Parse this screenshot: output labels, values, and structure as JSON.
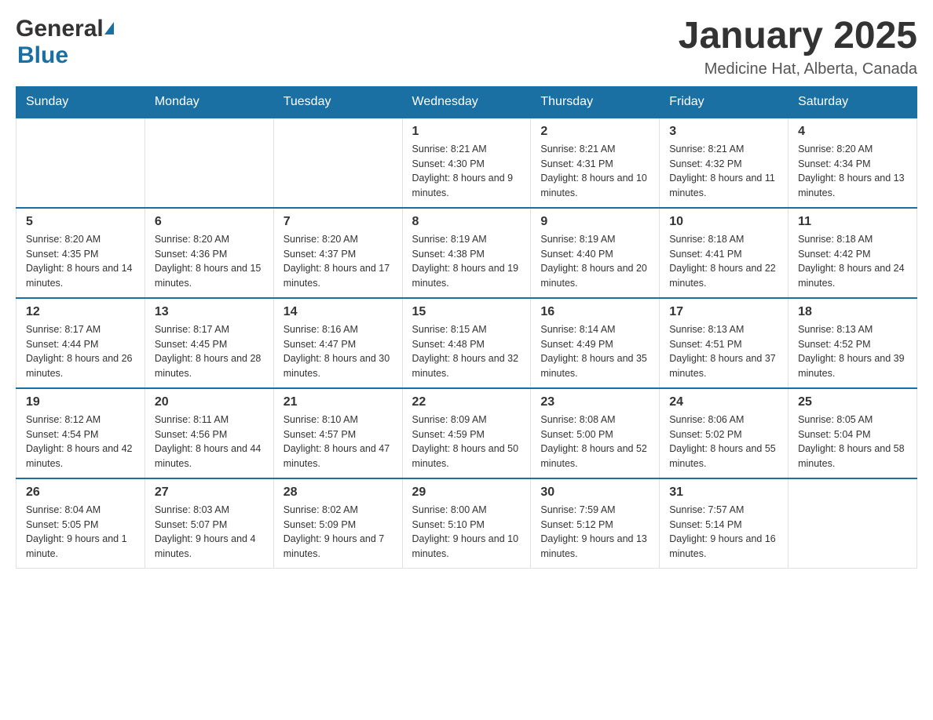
{
  "header": {
    "logo_general": "General",
    "logo_blue": "Blue",
    "title": "January 2025",
    "location": "Medicine Hat, Alberta, Canada"
  },
  "days_of_week": [
    "Sunday",
    "Monday",
    "Tuesday",
    "Wednesday",
    "Thursday",
    "Friday",
    "Saturday"
  ],
  "weeks": [
    [
      {
        "day": "",
        "info": ""
      },
      {
        "day": "",
        "info": ""
      },
      {
        "day": "",
        "info": ""
      },
      {
        "day": "1",
        "info": "Sunrise: 8:21 AM\nSunset: 4:30 PM\nDaylight: 8 hours and 9 minutes."
      },
      {
        "day": "2",
        "info": "Sunrise: 8:21 AM\nSunset: 4:31 PM\nDaylight: 8 hours and 10 minutes."
      },
      {
        "day": "3",
        "info": "Sunrise: 8:21 AM\nSunset: 4:32 PM\nDaylight: 8 hours and 11 minutes."
      },
      {
        "day": "4",
        "info": "Sunrise: 8:20 AM\nSunset: 4:34 PM\nDaylight: 8 hours and 13 minutes."
      }
    ],
    [
      {
        "day": "5",
        "info": "Sunrise: 8:20 AM\nSunset: 4:35 PM\nDaylight: 8 hours and 14 minutes."
      },
      {
        "day": "6",
        "info": "Sunrise: 8:20 AM\nSunset: 4:36 PM\nDaylight: 8 hours and 15 minutes."
      },
      {
        "day": "7",
        "info": "Sunrise: 8:20 AM\nSunset: 4:37 PM\nDaylight: 8 hours and 17 minutes."
      },
      {
        "day": "8",
        "info": "Sunrise: 8:19 AM\nSunset: 4:38 PM\nDaylight: 8 hours and 19 minutes."
      },
      {
        "day": "9",
        "info": "Sunrise: 8:19 AM\nSunset: 4:40 PM\nDaylight: 8 hours and 20 minutes."
      },
      {
        "day": "10",
        "info": "Sunrise: 8:18 AM\nSunset: 4:41 PM\nDaylight: 8 hours and 22 minutes."
      },
      {
        "day": "11",
        "info": "Sunrise: 8:18 AM\nSunset: 4:42 PM\nDaylight: 8 hours and 24 minutes."
      }
    ],
    [
      {
        "day": "12",
        "info": "Sunrise: 8:17 AM\nSunset: 4:44 PM\nDaylight: 8 hours and 26 minutes."
      },
      {
        "day": "13",
        "info": "Sunrise: 8:17 AM\nSunset: 4:45 PM\nDaylight: 8 hours and 28 minutes."
      },
      {
        "day": "14",
        "info": "Sunrise: 8:16 AM\nSunset: 4:47 PM\nDaylight: 8 hours and 30 minutes."
      },
      {
        "day": "15",
        "info": "Sunrise: 8:15 AM\nSunset: 4:48 PM\nDaylight: 8 hours and 32 minutes."
      },
      {
        "day": "16",
        "info": "Sunrise: 8:14 AM\nSunset: 4:49 PM\nDaylight: 8 hours and 35 minutes."
      },
      {
        "day": "17",
        "info": "Sunrise: 8:13 AM\nSunset: 4:51 PM\nDaylight: 8 hours and 37 minutes."
      },
      {
        "day": "18",
        "info": "Sunrise: 8:13 AM\nSunset: 4:52 PM\nDaylight: 8 hours and 39 minutes."
      }
    ],
    [
      {
        "day": "19",
        "info": "Sunrise: 8:12 AM\nSunset: 4:54 PM\nDaylight: 8 hours and 42 minutes."
      },
      {
        "day": "20",
        "info": "Sunrise: 8:11 AM\nSunset: 4:56 PM\nDaylight: 8 hours and 44 minutes."
      },
      {
        "day": "21",
        "info": "Sunrise: 8:10 AM\nSunset: 4:57 PM\nDaylight: 8 hours and 47 minutes."
      },
      {
        "day": "22",
        "info": "Sunrise: 8:09 AM\nSunset: 4:59 PM\nDaylight: 8 hours and 50 minutes."
      },
      {
        "day": "23",
        "info": "Sunrise: 8:08 AM\nSunset: 5:00 PM\nDaylight: 8 hours and 52 minutes."
      },
      {
        "day": "24",
        "info": "Sunrise: 8:06 AM\nSunset: 5:02 PM\nDaylight: 8 hours and 55 minutes."
      },
      {
        "day": "25",
        "info": "Sunrise: 8:05 AM\nSunset: 5:04 PM\nDaylight: 8 hours and 58 minutes."
      }
    ],
    [
      {
        "day": "26",
        "info": "Sunrise: 8:04 AM\nSunset: 5:05 PM\nDaylight: 9 hours and 1 minute."
      },
      {
        "day": "27",
        "info": "Sunrise: 8:03 AM\nSunset: 5:07 PM\nDaylight: 9 hours and 4 minutes."
      },
      {
        "day": "28",
        "info": "Sunrise: 8:02 AM\nSunset: 5:09 PM\nDaylight: 9 hours and 7 minutes."
      },
      {
        "day": "29",
        "info": "Sunrise: 8:00 AM\nSunset: 5:10 PM\nDaylight: 9 hours and 10 minutes."
      },
      {
        "day": "30",
        "info": "Sunrise: 7:59 AM\nSunset: 5:12 PM\nDaylight: 9 hours and 13 minutes."
      },
      {
        "day": "31",
        "info": "Sunrise: 7:57 AM\nSunset: 5:14 PM\nDaylight: 9 hours and 16 minutes."
      },
      {
        "day": "",
        "info": ""
      }
    ]
  ]
}
